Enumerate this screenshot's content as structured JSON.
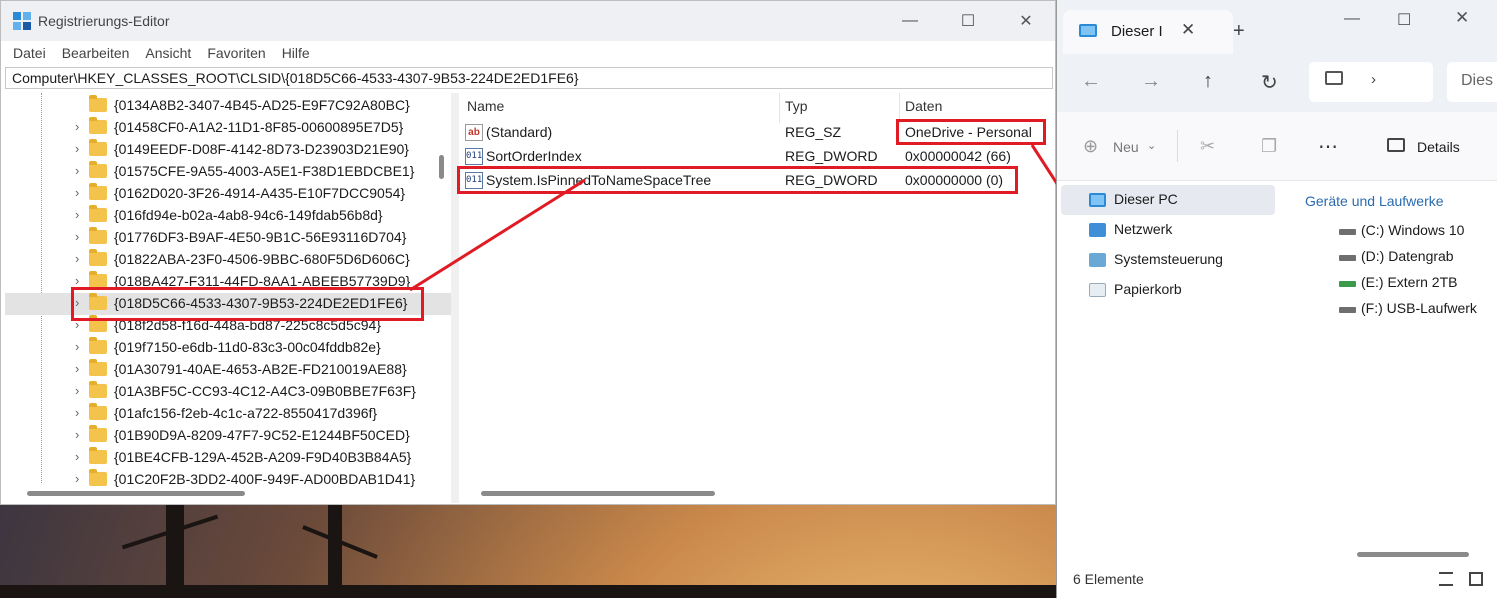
{
  "registry": {
    "title": "Registrierungs-Editor",
    "menu": [
      "Datei",
      "Bearbeiten",
      "Ansicht",
      "Favoriten",
      "Hilfe"
    ],
    "address": "Computer\\HKEY_CLASSES_ROOT\\CLSID\\{018D5C66-4533-4307-9B53-224DE2ED1FE6}",
    "tree": [
      "{0134A8B2-3407-4B45-AD25-E9F7C92A80BC}",
      "{01458CF0-A1A2-11D1-8F85-00600895E7D5}",
      "{0149EEDF-D08F-4142-8D73-D23903D21E90}",
      "{01575CFE-9A55-4003-A5E1-F38D1EBDCBE1}",
      "{0162D020-3F26-4914-A435-E10F7DCC9054}",
      "{016fd94e-b02a-4ab8-94c6-149fdab56b8d}",
      "{01776DF3-B9AF-4E50-9B1C-56E93116D704}",
      "{01822ABA-23F0-4506-9BBC-680F5D6D606C}",
      "{018BA427-F311-44FD-8AA1-ABEEB57739D9}",
      "{018D5C66-4533-4307-9B53-224DE2ED1FE6}",
      "{018f2d58-f16d-448a-bd87-225c8c5d5c94}",
      "{019f7150-e6db-11d0-83c3-00c04fddb82e}",
      "{01A30791-40AE-4653-AB2E-FD210019AE88}",
      "{01A3BF5C-CC93-4C12-A4C3-09B0BBE7F63F}",
      "{01afc156-f2eb-4c1c-a722-8550417d396f}",
      "{01B90D9A-8209-47F7-9C52-E1244BF50CED}",
      "{01BE4CFB-129A-452B-A209-F9D40B3B84A5}",
      "{01C20F2B-3DD2-400F-949F-AD00BDAB1D41}"
    ],
    "selected_index": 9,
    "columns": {
      "name": "Name",
      "type": "Typ",
      "data": "Daten"
    },
    "values": [
      {
        "icon": "ab",
        "name": "(Standard)",
        "type": "REG_SZ",
        "data": "OneDrive - Personal"
      },
      {
        "icon": "bin",
        "name": "SortOrderIndex",
        "type": "REG_DWORD",
        "data": "0x00000042 (66)"
      },
      {
        "icon": "bin",
        "name": "System.IsPinnedToNameSpaceTree",
        "type": "REG_DWORD",
        "data": "0x00000000 (0)"
      }
    ]
  },
  "explorer": {
    "tab_label": "Dieser I",
    "address_partial": "Dies",
    "toolbar": {
      "new_label": "Neu",
      "details_label": "Details"
    },
    "sidebar": [
      "Dieser PC",
      "Netzwerk",
      "Systemsteuerung",
      "Papierkorb"
    ],
    "section_header": "Geräte und Laufwerke",
    "drives": [
      "(C:) Windows 10",
      "(D:) Datengrab",
      "(E:) Extern 2TB",
      "(F:) USB-Laufwerk"
    ],
    "status": "6 Elemente"
  },
  "colors": {
    "highlight": "#e01b24",
    "accent": "#2b8ad8",
    "folder": "#f4c34b"
  }
}
